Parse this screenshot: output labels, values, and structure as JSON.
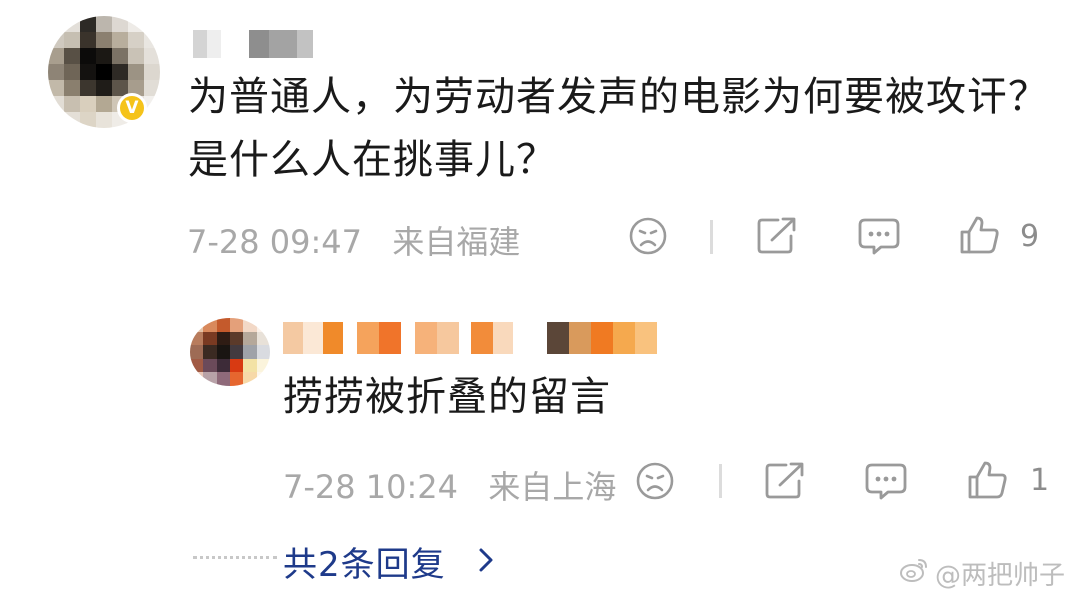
{
  "comment": {
    "text": "为普通人，为劳动者发声的电影为何要被攻讦？是什么人在挑事儿？",
    "time": "7-28 09:47",
    "location": "来自福建",
    "like_count": "9",
    "icons": [
      "dislike-face-icon",
      "share-icon",
      "comment-icon",
      "like-icon"
    ]
  },
  "reply": {
    "text": "捞捞被折叠的留言",
    "time": "7-28 10:24",
    "location": "来自上海",
    "like_count": "1",
    "icons": [
      "dislike-face-icon",
      "share-icon",
      "comment-icon",
      "like-icon"
    ]
  },
  "more_replies": {
    "label": "共2条回复"
  },
  "watermark": {
    "text": "@两把帅子"
  },
  "colors": {
    "text": "#1a1a1a",
    "meta": "#a8a8a8",
    "link": "#1e3a8a",
    "verified_badge": "#f5c31a"
  }
}
